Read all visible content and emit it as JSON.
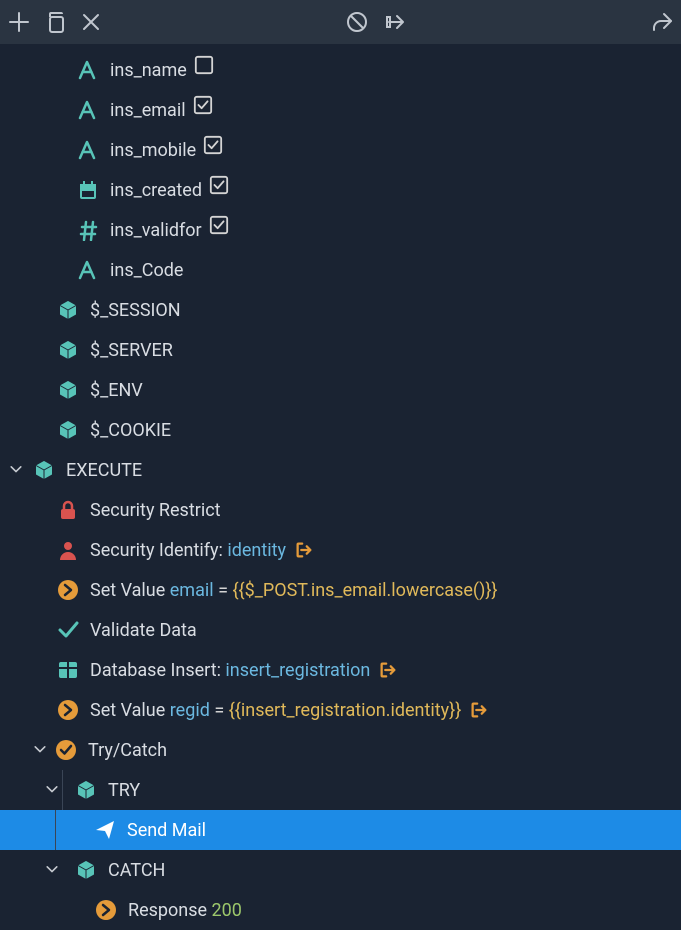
{
  "vars": {
    "ins_name": "ins_name",
    "ins_email": "ins_email",
    "ins_mobile": "ins_mobile",
    "ins_created": "ins_created",
    "ins_validfor": "ins_validfor",
    "ins_Code": "ins_Code"
  },
  "globals": {
    "session": "$_SESSION",
    "server": "$_SERVER",
    "env": "$_ENV",
    "cookie": "$_COOKIE"
  },
  "execute": {
    "label": "EXECUTE",
    "security_restrict": "Security Restrict",
    "security_identify": {
      "prefix": "Security Identify:",
      "value": "identity"
    },
    "set_value_email": {
      "prefix": "Set Value",
      "var": "email",
      "eq": "=",
      "expr": "{{$_POST.ins_email.lowercase()}}"
    },
    "validate": "Validate Data",
    "db_insert": {
      "prefix": "Database Insert:",
      "name": "insert_registration"
    },
    "set_value_regid": {
      "prefix": "Set Value",
      "var": "regid",
      "eq": "=",
      "expr": "{{insert_registration.identity}}"
    },
    "try_catch": "Try/Catch",
    "try": "TRY",
    "send_mail": "Send Mail",
    "catch": "CATCH",
    "response": {
      "prefix": "Response",
      "code": "200"
    }
  }
}
